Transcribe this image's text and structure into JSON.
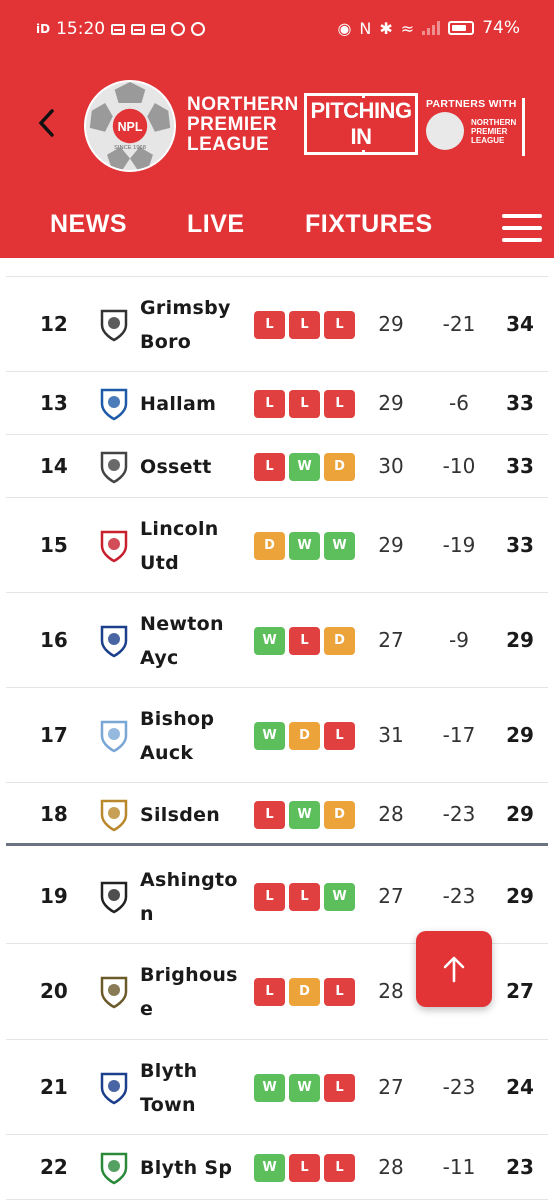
{
  "status_bar": {
    "carrier": "iD",
    "time": "15:20",
    "battery": "74%",
    "battery_level": 0.74
  },
  "header": {
    "logo_badge": "NPL",
    "logo_since": "SINCE 1968",
    "league_name": [
      "NORTHERN",
      "PREMIER",
      "LEAGUE"
    ],
    "sponsor_line1": "PITCHING",
    "sponsor_line2": "IN",
    "partners_with": "PARTNERS WITH",
    "partner_name": [
      "NORTHERN",
      "PREMIER",
      "LEAGUE"
    ]
  },
  "nav": {
    "items": [
      "NEWS",
      "LIVE",
      "FIXTURES"
    ]
  },
  "colors": {
    "brand_red": "#e23336",
    "win": "#5cbf5c",
    "loss": "#e0403f",
    "draw": "#eba33a"
  },
  "table": {
    "rows": [
      {
        "pos": "12",
        "team": [
          "Grimsby",
          "Boro"
        ],
        "form": [
          "L",
          "L",
          "L"
        ],
        "played": "29",
        "gd": "-21",
        "pts": "34"
      },
      {
        "pos": "13",
        "team": [
          "Hallam"
        ],
        "form": [
          "L",
          "L",
          "L"
        ],
        "played": "29",
        "gd": "-6",
        "pts": "33"
      },
      {
        "pos": "14",
        "team": [
          "Ossett"
        ],
        "form": [
          "L",
          "W",
          "D"
        ],
        "played": "30",
        "gd": "-10",
        "pts": "33"
      },
      {
        "pos": "15",
        "team": [
          "Lincoln",
          "Utd"
        ],
        "form": [
          "D",
          "W",
          "W"
        ],
        "played": "29",
        "gd": "-19",
        "pts": "33"
      },
      {
        "pos": "16",
        "team": [
          "Newton",
          "Ayc"
        ],
        "form": [
          "W",
          "L",
          "D"
        ],
        "played": "27",
        "gd": "-9",
        "pts": "29"
      },
      {
        "pos": "17",
        "team": [
          "Bishop",
          "Auck"
        ],
        "form": [
          "W",
          "D",
          "L"
        ],
        "played": "31",
        "gd": "-17",
        "pts": "29"
      },
      {
        "pos": "18",
        "team": [
          "Silsden"
        ],
        "form": [
          "L",
          "W",
          "D"
        ],
        "played": "28",
        "gd": "-23",
        "pts": "29"
      },
      {
        "pos": "19",
        "team": [
          "Ashingto",
          "n"
        ],
        "form": [
          "L",
          "L",
          "W"
        ],
        "played": "27",
        "gd": "-23",
        "pts": "29"
      },
      {
        "pos": "20",
        "team": [
          "Brighous",
          "e"
        ],
        "form": [
          "L",
          "D",
          "L"
        ],
        "played": "28",
        "gd": "",
        "pts": "27"
      },
      {
        "pos": "21",
        "team": [
          "Blyth",
          "Town"
        ],
        "form": [
          "W",
          "W",
          "L"
        ],
        "played": "27",
        "gd": "-23",
        "pts": "24"
      },
      {
        "pos": "22",
        "team": [
          "Blyth Sp"
        ],
        "form": [
          "W",
          "L",
          "L"
        ],
        "played": "28",
        "gd": "-11",
        "pts": "23"
      }
    ]
  },
  "icons": {
    "back": "chevron-left-icon",
    "menu": "hamburger-menu-icon",
    "scroll_top": "arrow-up-icon"
  }
}
